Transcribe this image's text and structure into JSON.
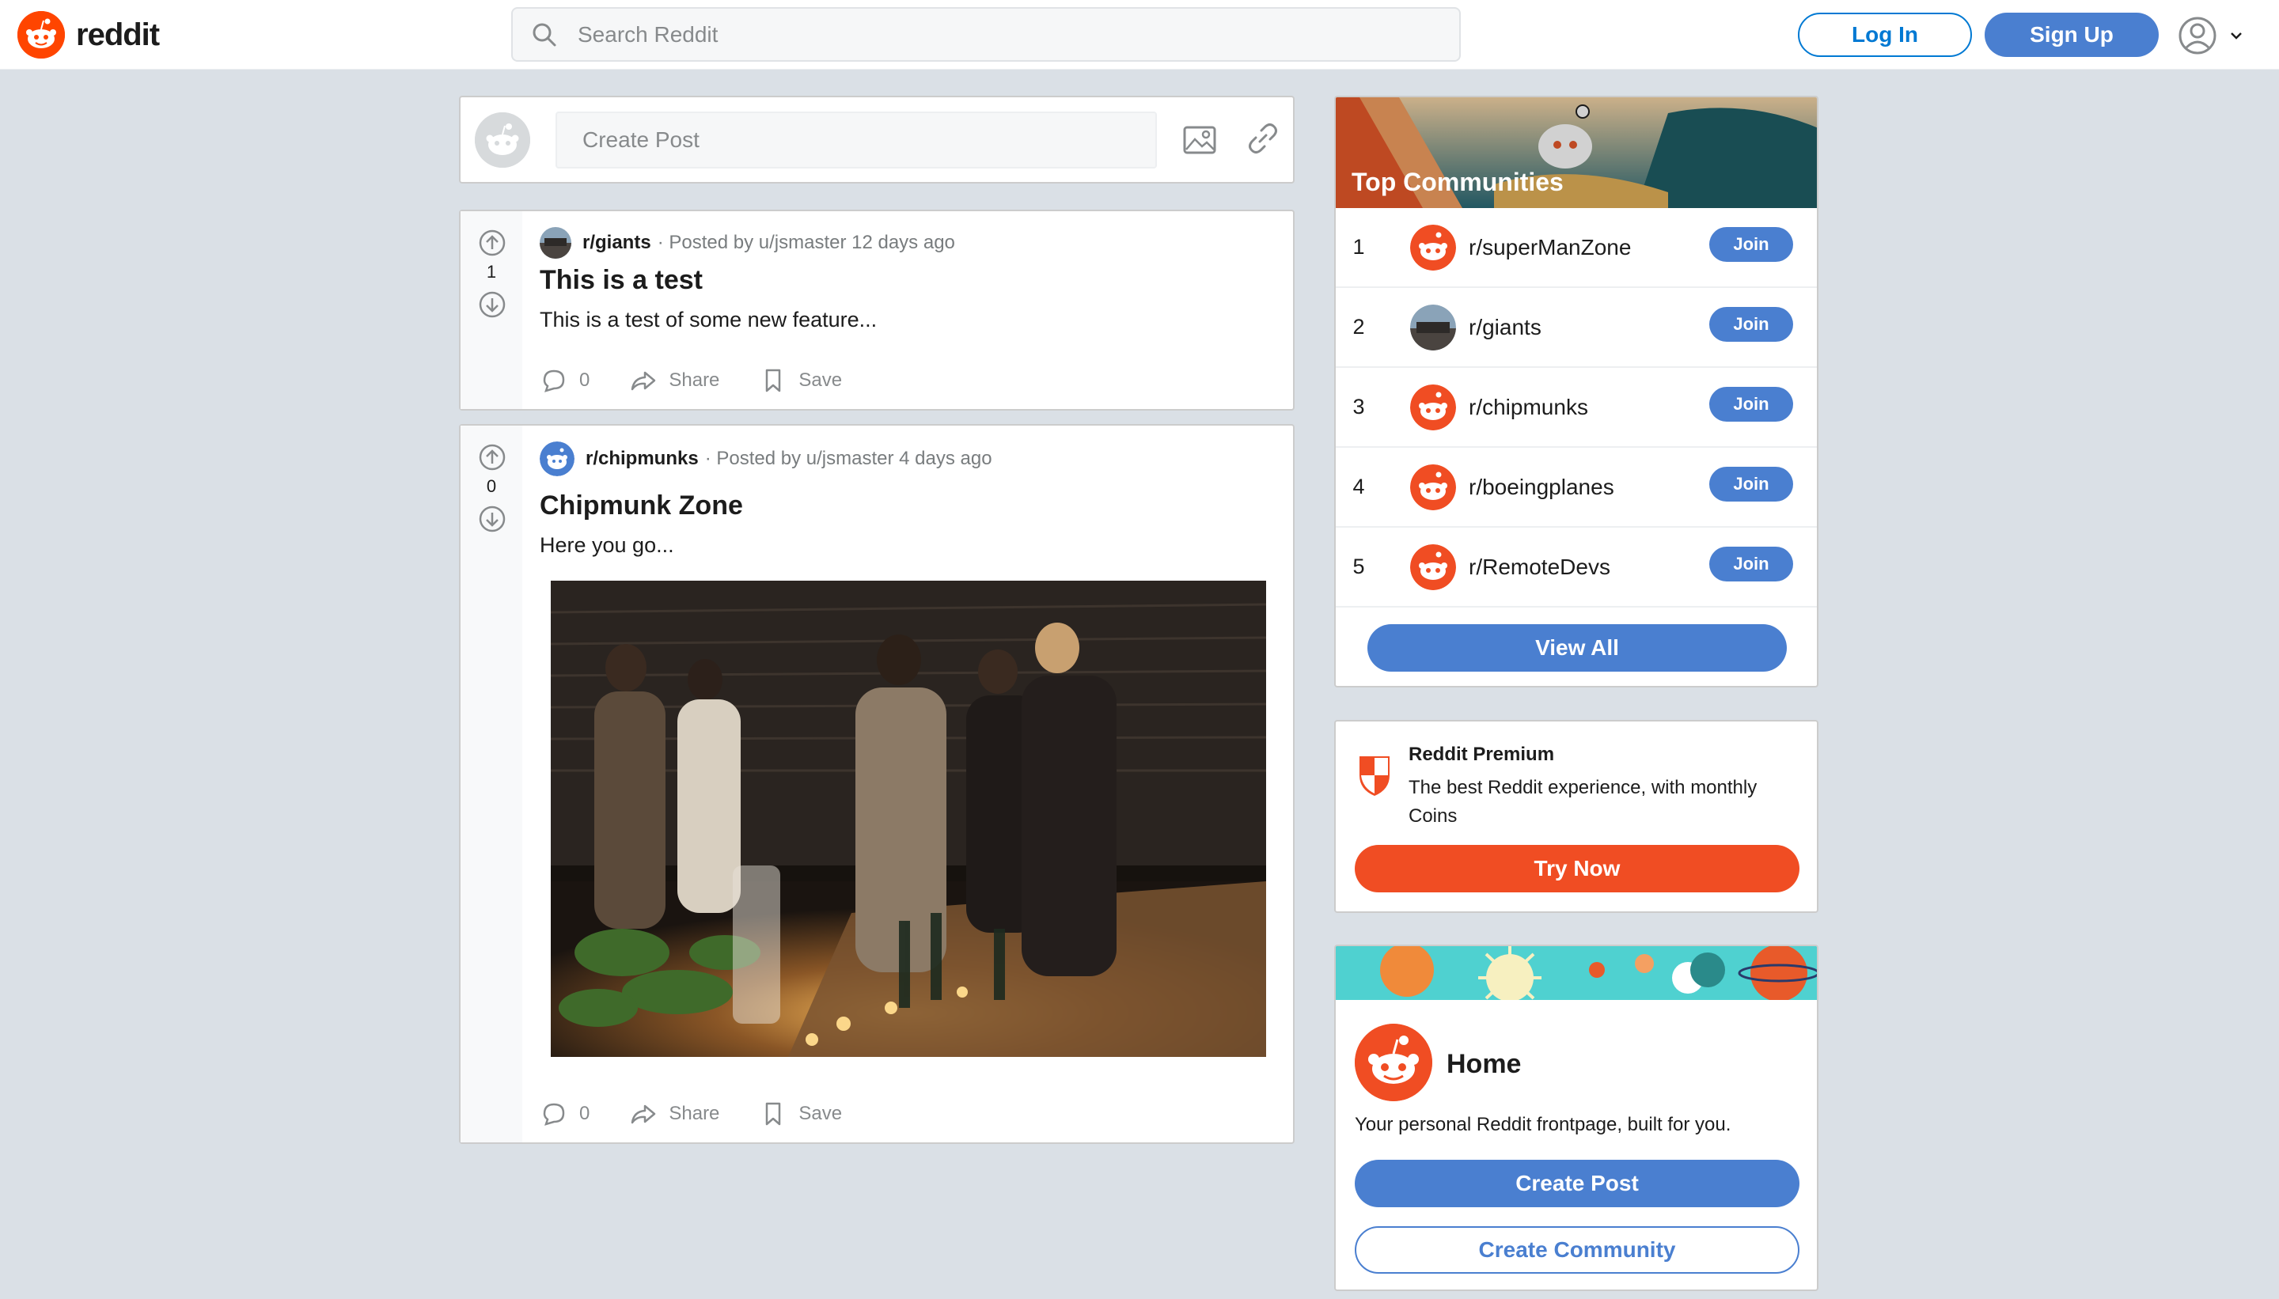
{
  "header": {
    "logo_text": "reddit",
    "search_placeholder": "Search Reddit",
    "login_label": "Log In",
    "signup_label": "Sign Up"
  },
  "create_post": {
    "placeholder": "Create Post"
  },
  "posts": [
    {
      "subreddit": "r/giants",
      "meta": "· Posted by u/jsmaster 12 days ago",
      "score": "1",
      "title": "This is a test",
      "body": "This is a test of some new feature...",
      "comments": "0",
      "share_label": "Share",
      "save_label": "Save"
    },
    {
      "subreddit": "r/chipmunks",
      "meta": "· Posted by u/jsmaster 4 days ago",
      "score": "0",
      "title": "Chipmunk Zone",
      "body": "Here you go...",
      "comments": "0",
      "share_label": "Share",
      "save_label": "Save"
    }
  ],
  "top_communities": {
    "title": "Top Communities",
    "items": [
      {
        "rank": "1",
        "name": "r/superManZone",
        "join": "Join"
      },
      {
        "rank": "2",
        "name": "r/giants",
        "join": "Join"
      },
      {
        "rank": "3",
        "name": "r/chipmunks",
        "join": "Join"
      },
      {
        "rank": "4",
        "name": "r/boeingplanes",
        "join": "Join"
      },
      {
        "rank": "5",
        "name": "r/RemoteDevs",
        "join": "Join"
      }
    ],
    "view_all": "View All"
  },
  "premium": {
    "title": "Reddit Premium",
    "description": "The best Reddit experience, with monthly Coins",
    "button": "Try Now"
  },
  "home": {
    "title": "Home",
    "description": "Your personal Reddit frontpage, built for you.",
    "create_post": "Create Post",
    "create_community": "Create Community"
  },
  "colors": {
    "brand_orange": "#ff4500",
    "button_blue": "#4a7fd0",
    "background": "#dae0e6"
  }
}
